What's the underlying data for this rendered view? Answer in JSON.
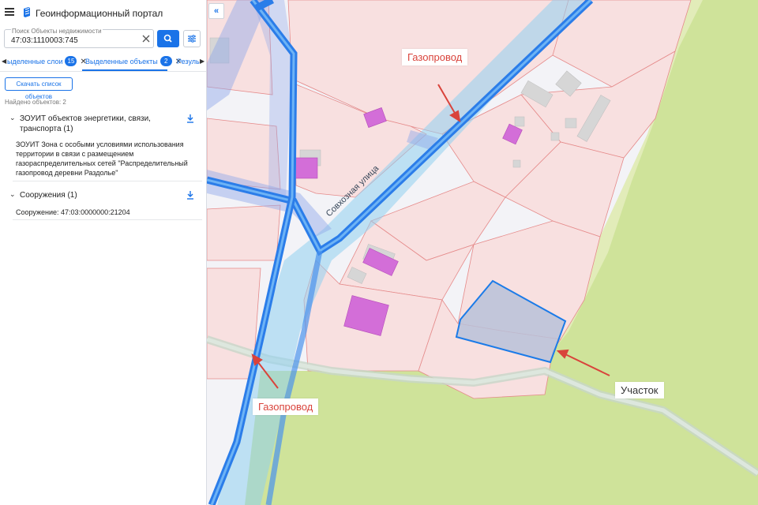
{
  "app": {
    "title": "Геоинформационный портал"
  },
  "search": {
    "label": "Поиск Объекты недвижимости",
    "value": "47:03:1110003:745"
  },
  "tabs": [
    {
      "label": "ыделенные слои",
      "badge": "15"
    },
    {
      "label": "Выделенные объекты",
      "badge": "2"
    },
    {
      "label": "Резуль"
    }
  ],
  "results": {
    "download_label": "Скачать список объектов",
    "found_label": "Найдено объектов: 2",
    "groups": [
      {
        "title": "ЗОУИТ объектов энергетики, связи, транспорта (1)",
        "item": "ЗОУИТ Зона с особыми условиями использования территории в связи с размещением газораспределительных сетей \"Распределительный газопровод деревни Раздолье\""
      },
      {
        "title": "Сооружения (1)",
        "item": "Сооружение: 47:03:0000000:21204"
      }
    ]
  },
  "map": {
    "street_label": "Совхозная улица",
    "annotations": {
      "pipeline_top": "Газопровод",
      "pipeline_bottom": "Газопровод",
      "plot": "Участок"
    },
    "colors": {
      "annotation_red": "#d9433b",
      "pipeline_blue": "#2b7de9",
      "plot_outline": "#1b7be8",
      "field_green": "#cfe39a"
    }
  },
  "icons": {
    "menu": "hamburger-icon",
    "logo": "logo-icon",
    "clear": "close-icon",
    "search": "search-icon",
    "filter": "filter-icon",
    "download": "download-icon",
    "collapse": "collapse-left-icon"
  }
}
